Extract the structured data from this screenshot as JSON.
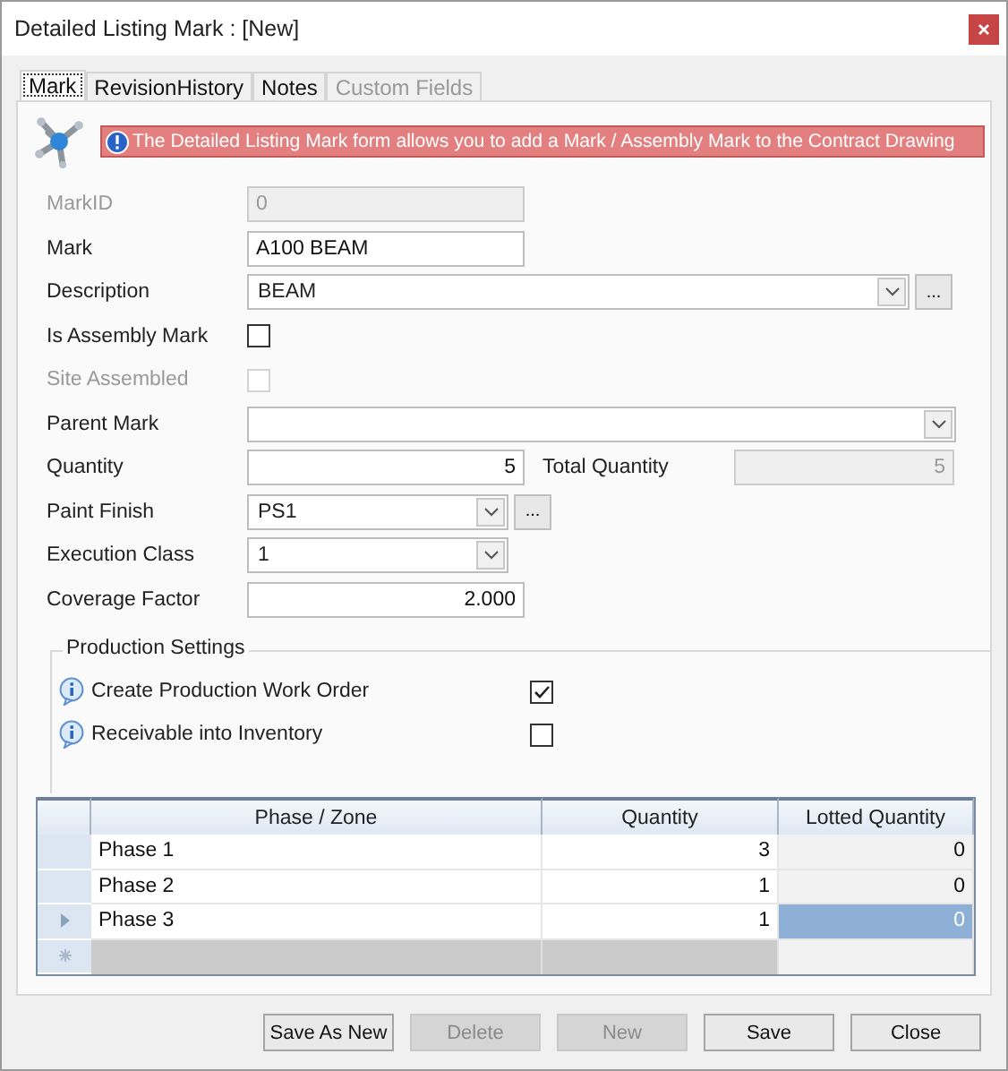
{
  "window": {
    "title": "Detailed Listing Mark : [New]"
  },
  "tabs": [
    {
      "label": "Mark",
      "selected": true,
      "disabled": false
    },
    {
      "label": "RevisionHistory",
      "selected": false,
      "disabled": false
    },
    {
      "label": "Notes",
      "selected": false,
      "disabled": false
    },
    {
      "label": "Custom Fields",
      "selected": false,
      "disabled": true
    }
  ],
  "banner": {
    "text": "The Detailed Listing Mark form allows you to add a Mark / Assembly Mark to the Contract Drawing"
  },
  "fields": [
    {
      "kind": "text",
      "label": "MarkID",
      "value": "0",
      "disabled": true,
      "numeric": false
    },
    {
      "kind": "text",
      "label": "Mark",
      "value": "A100 BEAM",
      "disabled": false,
      "numeric": false
    },
    {
      "kind": "combo",
      "label": "Description",
      "value": "BEAM",
      "button": "..."
    },
    {
      "kind": "checkbox",
      "label": "Is Assembly Mark",
      "checked": false,
      "disabled": false
    },
    {
      "kind": "checkbox",
      "label": "Site Assembled",
      "checked": false,
      "disabled": true
    },
    {
      "kind": "combo",
      "label": "Parent Mark"
    },
    {
      "kind": "text",
      "label": "Quantity",
      "value": "5",
      "disabled": false,
      "numeric": true,
      "extra": {
        "label": "Total Quantity",
        "value": "5",
        "disabled": true
      }
    },
    {
      "kind": "combo",
      "label": "Paint Finish",
      "value": "PS1",
      "button": "..."
    },
    {
      "kind": "combo",
      "label": "Execution Class",
      "value": "1"
    },
    {
      "kind": "text",
      "label": "Coverage Factor",
      "value": "2.000",
      "disabled": false,
      "numeric": true
    }
  ],
  "production_settings": {
    "title": "Production Settings",
    "items": [
      {
        "label": "Create Production Work Order",
        "checked": true
      },
      {
        "label": "Receivable into Inventory",
        "checked": false
      }
    ]
  },
  "grid": {
    "columns": [
      "Phase / Zone",
      "Quantity",
      "Lotted Quantity"
    ],
    "rows": [
      {
        "cells": [
          "Phase 1",
          "3",
          "0"
        ],
        "selected": false
      },
      {
        "cells": [
          "Phase 2",
          "1",
          "0"
        ],
        "selected": false
      },
      {
        "cells": [
          "Phase 3",
          "1",
          "0"
        ],
        "selected": true
      }
    ]
  },
  "buttons": [
    {
      "label": "Save As New",
      "disabled": false
    },
    {
      "label": "Delete",
      "disabled": true
    },
    {
      "label": "New",
      "disabled": true
    },
    {
      "label": "Save",
      "disabled": false
    },
    {
      "label": "Close",
      "disabled": false
    }
  ]
}
